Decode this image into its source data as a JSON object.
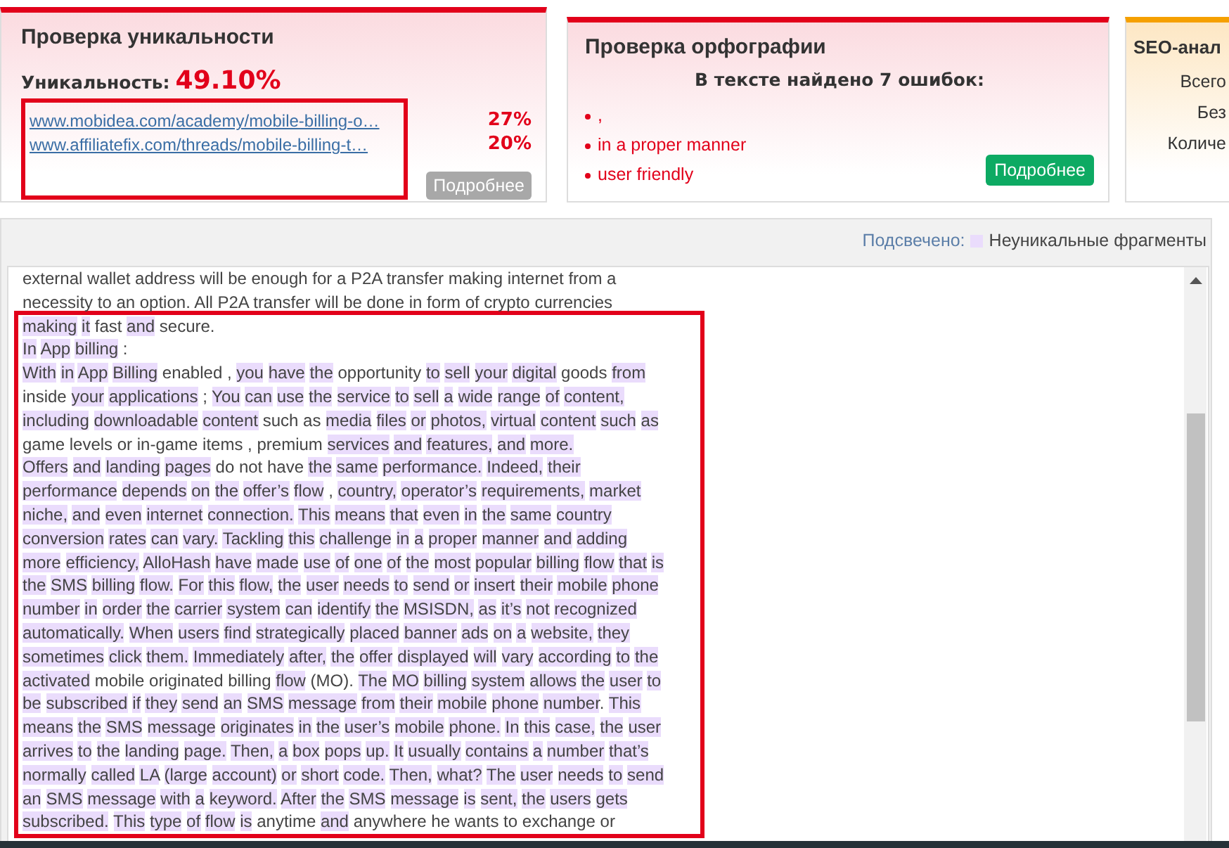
{
  "cards": [
    {
      "kind": "uniqueness",
      "title": "Проверка уникальности",
      "score_label": "Уникальность:",
      "score": "49.10%",
      "sources": [
        {
          "url": "www.mobidea.com/academy/mobile-billing-o…",
          "share": "27%"
        },
        {
          "url": "www.affiliatefix.com/threads/mobile-billing-t…",
          "share": "20%"
        }
      ],
      "button": "Подробнее"
    },
    {
      "kind": "spelling",
      "title": "Проверка орфографии",
      "summary": "В тексте найдено 7 ошибок:",
      "errors": [
        ",",
        "in a proper manner",
        "user friendly"
      ],
      "button": "Подробнее"
    },
    {
      "kind": "seo",
      "title": "SEO-анал",
      "lines": [
        "Всего",
        "Без",
        "Количе"
      ]
    }
  ],
  "legend": {
    "label": "Подсвечено:",
    "swatch_text": "Неуникальные фрагменты"
  },
  "text_lines": [
    {
      "segments": [
        {
          "text": "external wallet address will be enough for a P2A transfer making internet from a",
          "highlighted": false
        }
      ]
    },
    {
      "segments": [
        {
          "text": "necessity to an option. All P2A transfer will be done in form of crypto currencies",
          "highlighted": false
        }
      ]
    },
    {
      "segments": [
        {
          "text": "making it",
          "highlighted": true
        },
        {
          "text": " fast ",
          "highlighted": false
        },
        {
          "text": "and",
          "highlighted": true
        },
        {
          "text": " secure.",
          "highlighted": false
        }
      ]
    },
    {
      "segments": [
        {
          "text": "In App billing",
          "highlighted": true
        },
        {
          "text": " :",
          "highlighted": false
        }
      ]
    },
    {
      "segments": [
        {
          "text": "With in App Billing",
          "highlighted": true
        },
        {
          "text": " enabled , ",
          "highlighted": false
        },
        {
          "text": "you have the",
          "highlighted": true
        },
        {
          "text": " opportunity ",
          "highlighted": false
        },
        {
          "text": "to sell your digital",
          "highlighted": true
        },
        {
          "text": " goods ",
          "highlighted": false
        },
        {
          "text": "from",
          "highlighted": true
        }
      ]
    },
    {
      "segments": [
        {
          "text": "inside ",
          "highlighted": false
        },
        {
          "text": "your applications",
          "highlighted": true
        },
        {
          "text": " ; ",
          "highlighted": false
        },
        {
          "text": "You can use the service to sell a wide range of content,",
          "highlighted": true
        }
      ]
    },
    {
      "segments": [
        {
          "text": "including downloadable content",
          "highlighted": true
        },
        {
          "text": " such as ",
          "highlighted": false
        },
        {
          "text": "media files or photos, virtual content such as",
          "highlighted": true
        }
      ]
    },
    {
      "segments": [
        {
          "text": "game levels or in-game items , premium ",
          "highlighted": false
        },
        {
          "text": "services and features, and more.",
          "highlighted": true
        }
      ]
    },
    {
      "segments": [
        {
          "text": "Offers and landing pages",
          "highlighted": true
        },
        {
          "text": " do not have ",
          "highlighted": false
        },
        {
          "text": "the same performance. Indeed, their",
          "highlighted": true
        }
      ]
    },
    {
      "segments": [
        {
          "text": "performance depends on the offer’s flow",
          "highlighted": true
        },
        {
          "text": " , ",
          "highlighted": false
        },
        {
          "text": "country, operator’s requirements, market",
          "highlighted": true
        }
      ]
    },
    {
      "segments": [
        {
          "text": "niche, and even internet connection. This means that even in the same country",
          "highlighted": true
        }
      ]
    },
    {
      "segments": [
        {
          "text": "conversion rates can vary. Tackling this challenge in a proper manner and adding",
          "highlighted": true
        }
      ]
    },
    {
      "segments": [
        {
          "text": "more efficiency, AlloHash have made use of one of the most popular billing flow that is",
          "highlighted": true
        }
      ]
    },
    {
      "segments": [
        {
          "text": "the SMS billing flow. For this flow, the user needs to send or insert their mobile phone",
          "highlighted": true
        }
      ]
    },
    {
      "segments": [
        {
          "text": "number in order the carrier system can identify the MSISDN, as it’s not recognized",
          "highlighted": true
        }
      ]
    },
    {
      "segments": [
        {
          "text": "automatically. When users find strategically placed banner ads on a website, they",
          "highlighted": true
        }
      ]
    },
    {
      "segments": [
        {
          "text": "sometimes click them. Immediately after, the offer displayed will vary according to the",
          "highlighted": true
        }
      ]
    },
    {
      "segments": [
        {
          "text": "activated",
          "highlighted": true
        },
        {
          "text": " mobile originated billing ",
          "highlighted": false
        },
        {
          "text": "flow",
          "highlighted": true
        },
        {
          "text": " (MO). ",
          "highlighted": false
        },
        {
          "text": "The MO billing system allows the user to",
          "highlighted": true
        }
      ]
    },
    {
      "segments": [
        {
          "text": "be subscribed if they send an SMS message from their mobile phone number",
          "highlighted": true
        },
        {
          "text": ". ",
          "highlighted": false
        },
        {
          "text": "This",
          "highlighted": true
        }
      ]
    },
    {
      "segments": [
        {
          "text": "means the SMS message originates in the user’s mobile phone. In this case, the user",
          "highlighted": true
        }
      ]
    },
    {
      "segments": [
        {
          "text": "arrives to the landing page. Then, a box pops up. It usually contains a number that’s",
          "highlighted": true
        }
      ]
    },
    {
      "segments": [
        {
          "text": "normally called LA (large account) or short code. Then, what? The user needs to send",
          "highlighted": true
        }
      ]
    },
    {
      "segments": [
        {
          "text": "an SMS message with a keyword. After the SMS message is sent, the users gets",
          "highlighted": true
        }
      ]
    },
    {
      "segments": [
        {
          "text": "subscribed. This type of flow is",
          "highlighted": true
        },
        {
          "text": " anytime ",
          "highlighted": false
        },
        {
          "text": "and",
          "highlighted": true
        },
        {
          "text": " anywhere he wants to exchange or",
          "highlighted": false
        }
      ]
    }
  ]
}
